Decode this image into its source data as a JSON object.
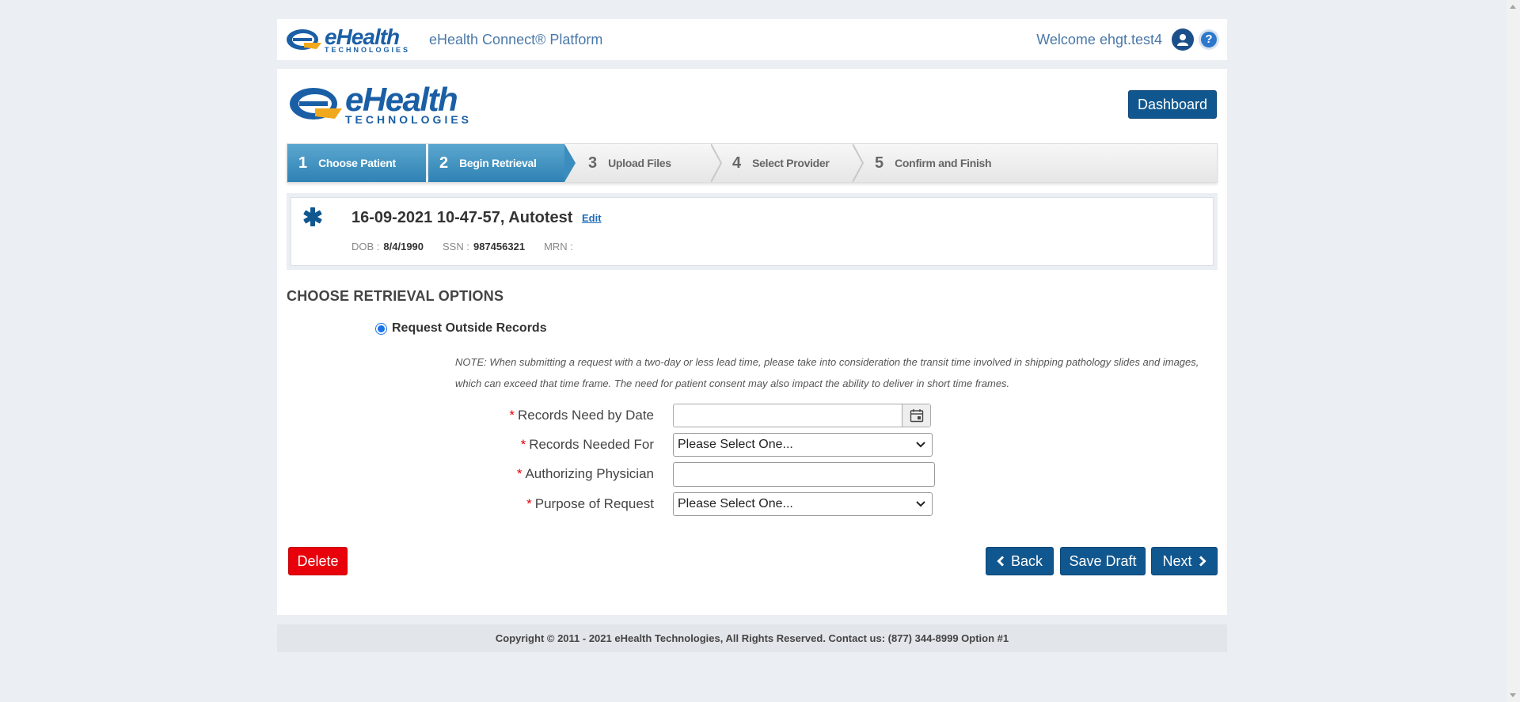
{
  "header": {
    "logo_main": "eHealth",
    "logo_sub": "TECHNOLOGIES",
    "platform_title": "eHealth Connect® Platform",
    "welcome": "Welcome ehgt.test4",
    "help_symbol": "?"
  },
  "page": {
    "logo_main": "eHealth",
    "logo_sub": "TECHNOLOGIES",
    "dashboard_label": "Dashboard"
  },
  "wizard": {
    "current_step": 2,
    "steps": [
      {
        "num": "1",
        "label": "Choose Patient"
      },
      {
        "num": "2",
        "label": "Begin Retrieval"
      },
      {
        "num": "3",
        "label": "Upload Files"
      },
      {
        "num": "4",
        "label": "Select Provider"
      },
      {
        "num": "5",
        "label": "Confirm and Finish"
      }
    ]
  },
  "patient": {
    "name": "16-09-2021 10-47-57, Autotest",
    "edit_label": "Edit",
    "dob_label": "DOB :",
    "dob": "8/4/1990",
    "ssn_label": "SSN :",
    "ssn": "987456321",
    "mrn_label": "MRN :",
    "mrn": ""
  },
  "retrieval": {
    "heading": "CHOOSE RETRIEVAL OPTIONS",
    "option_label": "Request Outside Records",
    "option_selected": true,
    "note": "NOTE: When submitting a request with a two-day or less lead time, please take into consideration the transit time involved in shipping pathology slides and images, which can exceed that time frame. The need for patient consent may also impact the ability to deliver in short time frames.",
    "fields": {
      "date_label": "Records Need by Date",
      "date_value": "",
      "needed_for_label": "Records Needed For",
      "needed_for_value": "Please Select One...",
      "physician_label": "Authorizing Physician",
      "physician_value": "",
      "purpose_label": "Purpose of Request",
      "purpose_value": "Please Select One...",
      "required_mark": "*"
    }
  },
  "actions": {
    "delete": "Delete",
    "back": "Back",
    "save_draft": "Save Draft",
    "next": "Next"
  },
  "footer": {
    "copyright": "Copyright © 2011 - 2021 eHealth Technologies, All Rights Reserved. Contact us: (877) 344-8999 Option #1"
  },
  "colors": {
    "primary_button": "#11578f",
    "delete_button": "#e8000b",
    "step_done": "#3a8dbe",
    "brand_blue": "#1a5fa6",
    "background": "#ebeef2"
  }
}
